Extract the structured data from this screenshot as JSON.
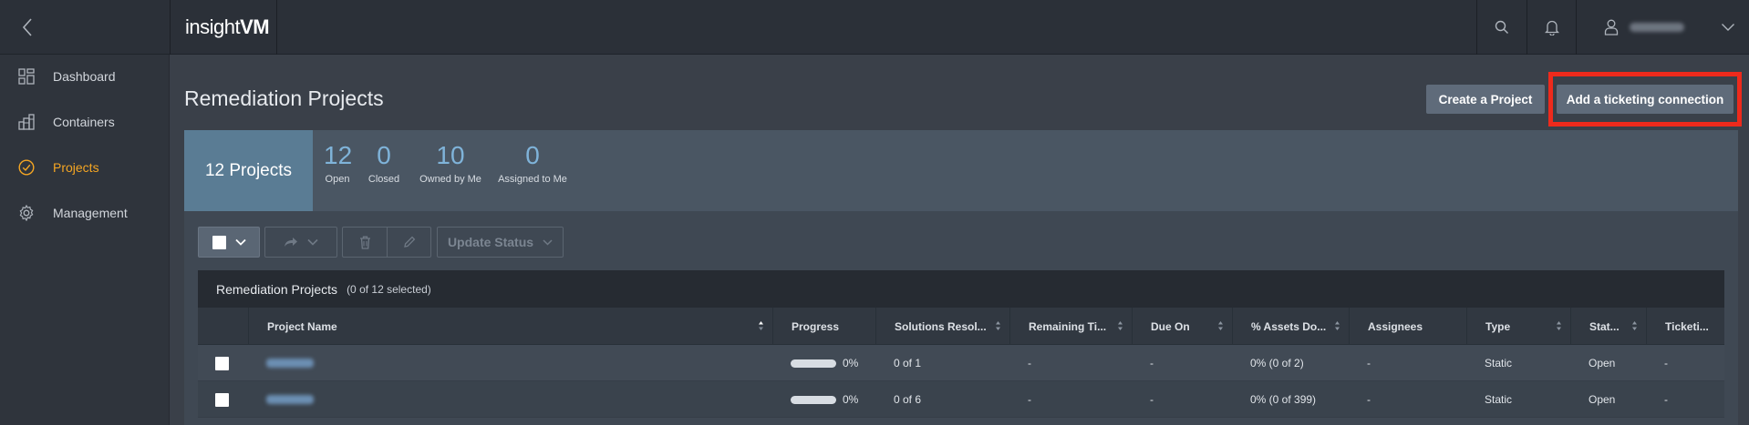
{
  "app": {
    "logo_light": "insight",
    "logo_bold": "VM",
    "user_name": "●●●●●●●"
  },
  "sidebar": {
    "items": [
      {
        "label": "Dashboard",
        "icon": "dashboard-grid-icon",
        "active": false
      },
      {
        "label": "Containers",
        "icon": "containers-icon",
        "active": false
      },
      {
        "label": "Projects",
        "icon": "check-circle-icon",
        "active": true
      },
      {
        "label": "Management",
        "icon": "gear-icon",
        "active": false
      }
    ]
  },
  "page": {
    "title": "Remediation Projects",
    "create_button": "Create a Project",
    "ticket_button": "Add a ticketing connection"
  },
  "summary": {
    "total_label": "12 Projects",
    "stats": [
      {
        "value": "12",
        "label": "Open"
      },
      {
        "value": "0",
        "label": "Closed"
      },
      {
        "value": "10",
        "label": "Owned by Me"
      },
      {
        "value": "0",
        "label": "Assigned to Me"
      }
    ]
  },
  "toolbar": {
    "update_status": "Update Status"
  },
  "table": {
    "caption": "Remediation Projects",
    "selection": "(0 of 12 selected)",
    "columns": [
      "Project Name",
      "Progress",
      "Solutions Resol...",
      "Remaining Ti...",
      "Due On",
      "% Assets Do...",
      "Assignees",
      "Type",
      "Stat...",
      "Ticketi..."
    ],
    "rows": [
      {
        "name": "●●●●●●",
        "progress": "0%",
        "progress_fraction": 0,
        "solutions": "0 of 1",
        "remaining": "-",
        "due": "-",
        "assets": "0% (0 of 2)",
        "assignees": "-",
        "type": "Static",
        "status": "Open",
        "ticketing": "-"
      },
      {
        "name": "●●●●●●",
        "progress": "0%",
        "progress_fraction": 0,
        "solutions": "0 of 6",
        "remaining": "-",
        "due": "-",
        "assets": "0% (0 of 399)",
        "assignees": "-",
        "type": "Static",
        "status": "Open",
        "ticketing": "-"
      }
    ]
  },
  "colors": {
    "accent": "#f5a623",
    "highlight": "#ee2a1c",
    "stat_value": "#7fb3d9"
  }
}
